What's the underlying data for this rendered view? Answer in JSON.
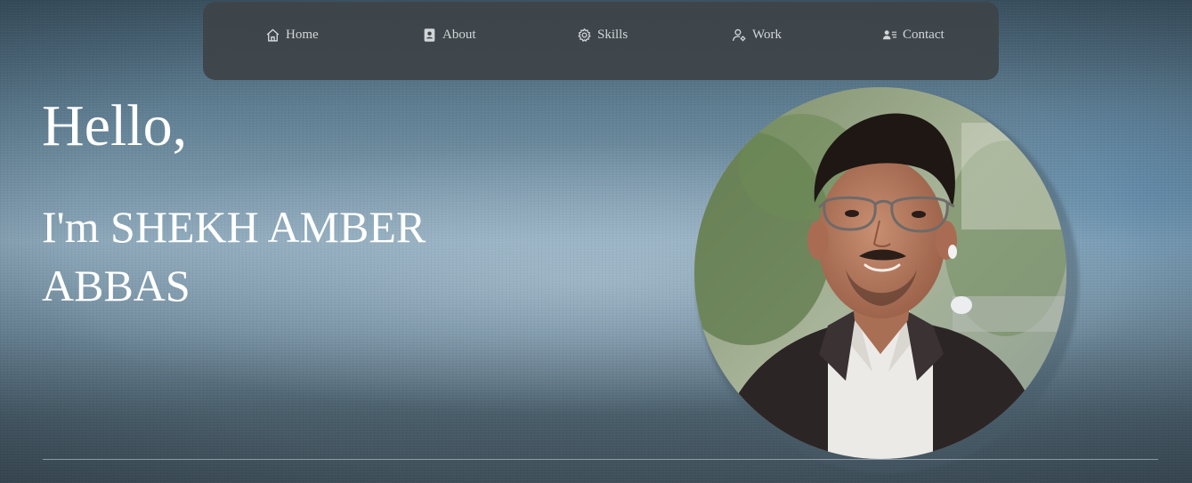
{
  "nav": {
    "items": [
      {
        "label": "Home",
        "icon": "home-icon"
      },
      {
        "label": "About",
        "icon": "contact-book-icon"
      },
      {
        "label": "Skills",
        "icon": "gear-icon"
      },
      {
        "label": "Work",
        "icon": "user-gear-icon"
      },
      {
        "label": "Contact",
        "icon": "contact-card-icon"
      }
    ]
  },
  "hero": {
    "greeting": "Hello,",
    "intro": "I'm SHEKH AMBER ABBAS"
  },
  "colors": {
    "nav_background": "#3e4448",
    "nav_text": "#d2d6d9",
    "hero_text": "#ffffff"
  }
}
